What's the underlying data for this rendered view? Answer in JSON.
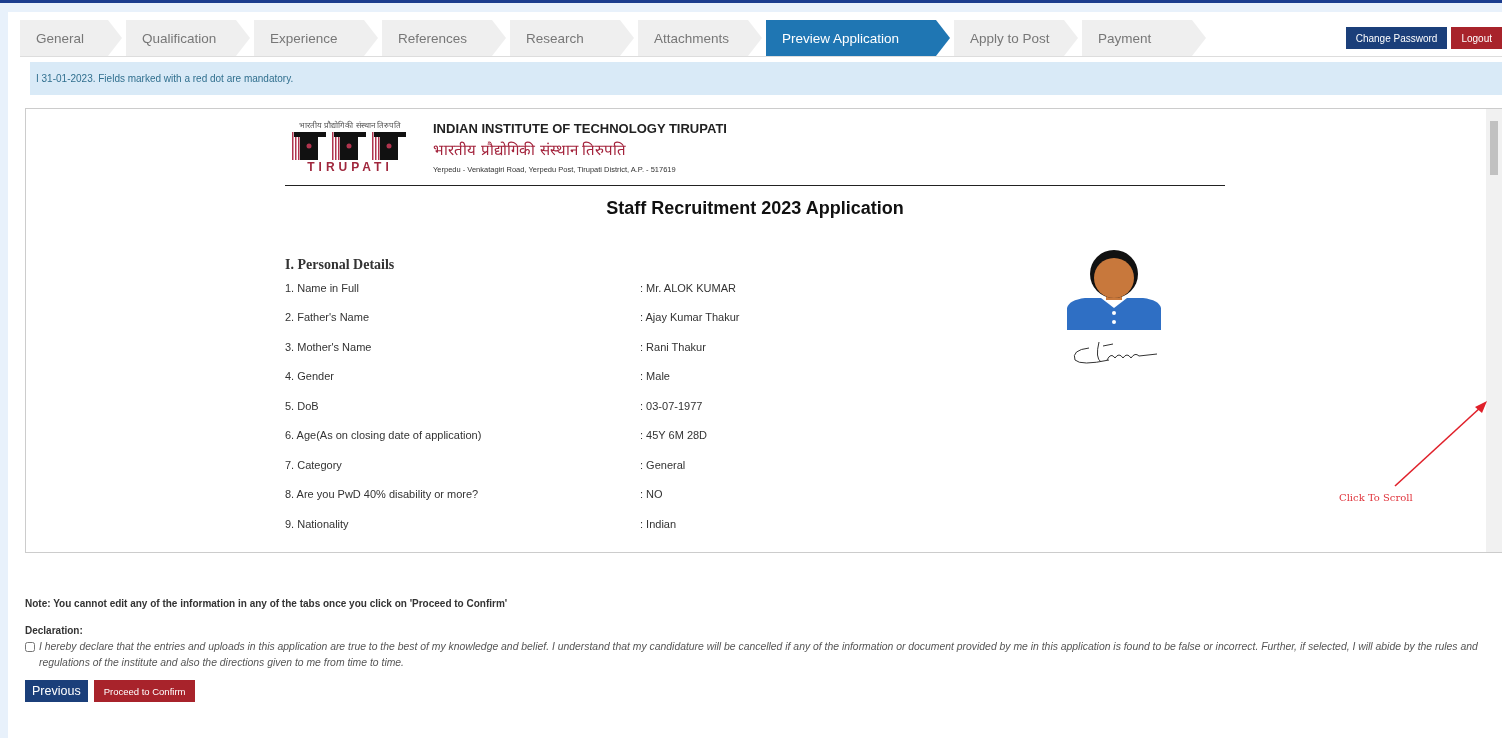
{
  "tabs": [
    {
      "label": "General",
      "selected": false
    },
    {
      "label": "Qualification",
      "selected": false
    },
    {
      "label": "Experience",
      "selected": false
    },
    {
      "label": "References",
      "selected": false
    },
    {
      "label": "Research",
      "selected": false
    },
    {
      "label": "Attachments",
      "selected": false
    },
    {
      "label": "Preview Application",
      "selected": true
    },
    {
      "label": "Apply to Post",
      "selected": false
    },
    {
      "label": "Payment",
      "selected": false
    }
  ],
  "header_buttons": [
    {
      "label": "Change Password",
      "kind": "primary"
    },
    {
      "label": "Logout",
      "kind": "danger"
    }
  ],
  "notice": "I 31-01-2023. Fields marked with a red dot are mandatory.",
  "document": {
    "logo_tagline": "भारतीय प्रौद्योगिकी संस्थान तिरुपति",
    "logo_caption": "TIRUPATI",
    "institute_name": "INDIAN INSTITUTE OF TECHNOLOGY TIRUPATI",
    "institute_name_hindi": "भारतीय प्रौद्योगिकी संस्थान तिरुपति",
    "address": "Yerpedu - Venkatagiri Road, Yerpedu Post, Tirupati District, A.P. - 517619",
    "title": "Staff Recruitment 2023 Application",
    "section_heading": "I. Personal Details",
    "fields": [
      {
        "label": "1. Name in Full",
        "value": ": Mr. ALOK KUMAR"
      },
      {
        "label": "2. Father's Name",
        "value": ": Ajay Kumar Thakur"
      },
      {
        "label": "3. Mother's Name",
        "value": ": Rani Thakur"
      },
      {
        "label": "4. Gender",
        "value": ": Male"
      },
      {
        "label": "5. DoB",
        "value": ": 03-07-1977"
      },
      {
        "label": "6. Age(As on closing date of application)",
        "value": ": 45Y 6M 28D"
      },
      {
        "label": "7. Category",
        "value": ": General"
      },
      {
        "label": "8. Are you PwD 40% disability or more?",
        "value": ": NO"
      },
      {
        "label": "9. Nationality",
        "value": ": Indian"
      }
    ],
    "scroll_hint": "Click To Scroll"
  },
  "note": "Note: You cannot edit any of the information in any of the tabs once you click on 'Proceed to Confirm'",
  "declaration": {
    "heading": "Declaration:",
    "text": "I hereby declare that the entries and uploads in this application are true to the best of my knowledge and belief. I understand that my candidature will be cancelled if any of the information or document provided by me in this application is found to be false or incorrect. Further, if selected, I will abide by the rules and regulations of the institute and also the directions given to me from time to time.",
    "checked": false
  },
  "actions": [
    {
      "label": "Previous",
      "kind": "primary"
    },
    {
      "label": "Proceed to Confirm",
      "kind": "danger"
    }
  ]
}
